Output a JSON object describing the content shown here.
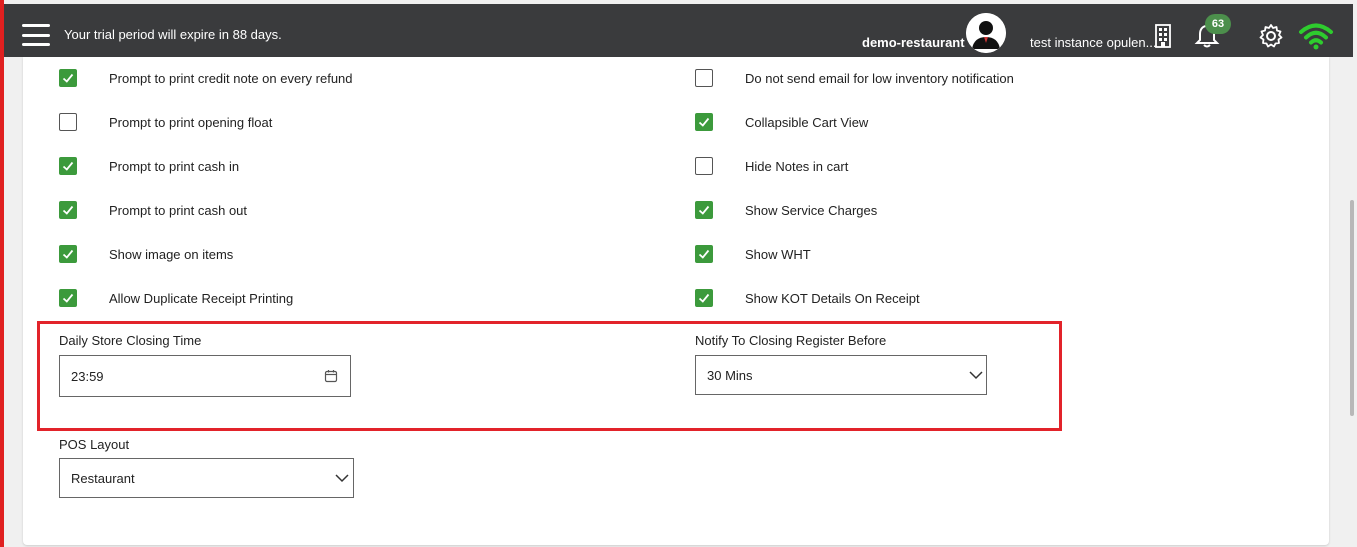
{
  "topbar": {
    "trial_message": "Your trial period will expire in 88 days.",
    "restaurant_name": "demo-restaurant",
    "instance_name": "test instance opulen...",
    "notification_count": "63"
  },
  "settings": {
    "left_checks": [
      {
        "label": "Prompt to print credit note on every refund",
        "checked": true
      },
      {
        "label": "Prompt to print opening float",
        "checked": false
      },
      {
        "label": "Prompt to print cash in",
        "checked": true
      },
      {
        "label": "Prompt to print cash out",
        "checked": true
      },
      {
        "label": "Show image on items",
        "checked": true
      },
      {
        "label": "Allow Duplicate Receipt Printing",
        "checked": true
      }
    ],
    "right_checks": [
      {
        "label": "Do not send email for low inventory notification",
        "checked": false
      },
      {
        "label": "Collapsible Cart View",
        "checked": true
      },
      {
        "label": "Hide Notes in cart",
        "checked": false
      },
      {
        "label": "Show Service Charges",
        "checked": true
      },
      {
        "label": "Show WHT",
        "checked": true
      },
      {
        "label": "Show KOT Details On Receipt",
        "checked": true
      }
    ],
    "closing_time": {
      "label": "Daily Store Closing Time",
      "value": "23:59"
    },
    "notify_before": {
      "label": "Notify To Closing Register Before",
      "value": "30 Mins"
    },
    "pos_layout": {
      "label": "POS Layout",
      "value": "Restaurant"
    }
  },
  "colors": {
    "topbar_bg": "#3a3b3d",
    "check_green": "#3c9a3c",
    "highlight_red": "#e2232a",
    "wifi_green": "#2ecc2e"
  }
}
